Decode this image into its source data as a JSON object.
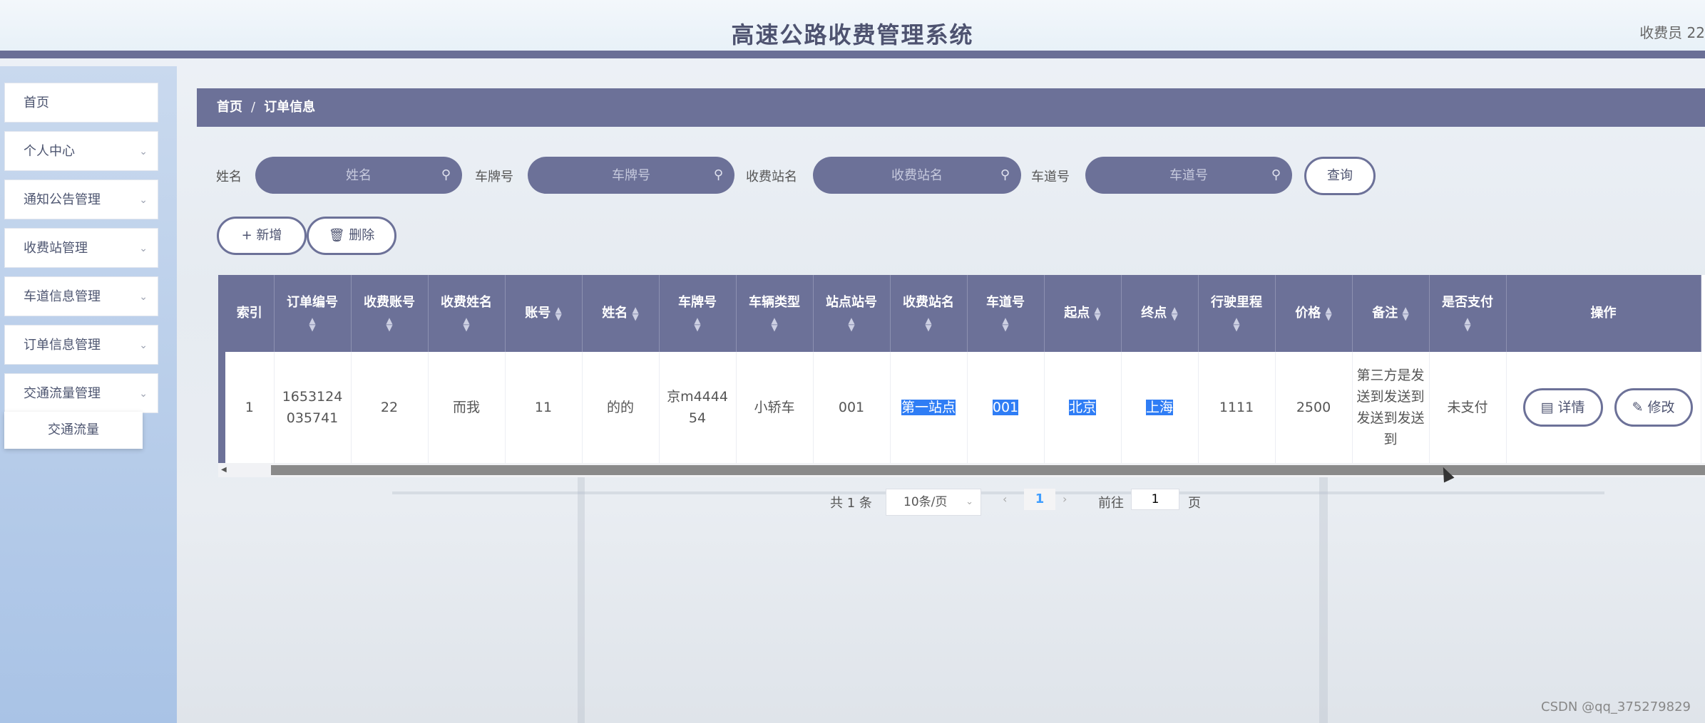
{
  "header": {
    "title": "高速公路收费管理系统",
    "user": "收费员 22"
  },
  "sidebar": {
    "items": [
      {
        "label": "首页"
      },
      {
        "label": "个人中心"
      },
      {
        "label": "通知公告管理"
      },
      {
        "label": "收费站管理"
      },
      {
        "label": "车道信息管理"
      },
      {
        "label": "订单信息管理"
      },
      {
        "label": "交通流量管理"
      }
    ],
    "submenu": {
      "label": "交通流量"
    }
  },
  "breadcrumb": {
    "home": "首页",
    "separator": "/",
    "current": "订单信息"
  },
  "search": {
    "name_label": "姓名",
    "name_placeholder": "姓名",
    "plate_label": "车牌号",
    "plate_placeholder": "车牌号",
    "station_label": "收费站名",
    "station_placeholder": "收费站名",
    "lane_label": "车道号",
    "lane_placeholder": "车道号",
    "query_button": "查询"
  },
  "toolbar": {
    "add_button": "+ 新增",
    "delete_button": "删除"
  },
  "table": {
    "columns": [
      "索引",
      "订单编号",
      "收费账号",
      "收费姓名",
      "账号",
      "姓名",
      "车牌号",
      "车辆类型",
      "站点站号",
      "收费站名",
      "车道号",
      "起点",
      "终点",
      "行驶里程",
      "价格",
      "备注",
      "是否支付",
      "操作"
    ],
    "rows": [
      {
        "index": "1",
        "order_no": "1653124035741",
        "toll_account": "22",
        "toll_name": "而我",
        "account": "11",
        "name": "的的",
        "plate": "京m444454",
        "vehicle_type": "小轿车",
        "station_no": "001",
        "station_name": "第一站点",
        "lane_no": "001",
        "start": "北京",
        "end": "上海",
        "mileage": "1111",
        "price": "2500",
        "remark": "第三方是发送到发送到发送到发送到",
        "paid": "未支付",
        "detail_button": "详情",
        "edit_button": "修改"
      }
    ]
  },
  "pagination": {
    "total": "共 1 条",
    "page_size": "10条/页",
    "current_page": "1",
    "goto_label": "前往",
    "goto_value": "1",
    "page_suffix": "页"
  },
  "watermark": "CSDN @qq_375279829"
}
